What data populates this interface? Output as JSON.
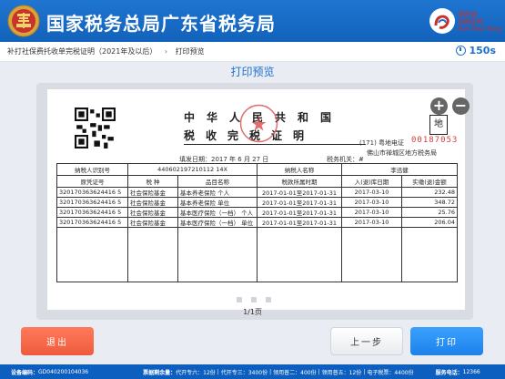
{
  "header": {
    "title": "国家税务总局广东省税务局",
    "brand_line1": "粤税通",
    "brand_line2": "自助办税",
    "brand_line3": "Yue Shui Tong"
  },
  "breadcrumb": {
    "item1": "补打社保费托收单完税证明（2021年及以后）",
    "separator": "›",
    "item2": "打印预览"
  },
  "timer": {
    "text": "150s"
  },
  "page_title": "打印预览",
  "certificate": {
    "title_line1": "中华人民共和国",
    "title_line2": "税收完税证明",
    "cert_no_label": "(171) 粤地电证",
    "cert_no": "00187053",
    "office": "佛山市禅城区地方税务局",
    "stamp_char": "地",
    "fill_date": "填发日期：2017 年 6 月 27 日",
    "tax_org": "税务机关：#",
    "taxpayer_id_label": "纳税人识别号",
    "taxpayer_id": "440602197210112 14X",
    "taxpayer_name_label": "纳税人名称",
    "taxpayer_name": "李迅健",
    "columns": [
      "原凭证号",
      "税 种",
      "品目名称",
      "税款所属时期",
      "入(退)库日期",
      "实缴(退)金额"
    ],
    "rows": [
      [
        "320170363624416 5",
        "社会保险基金",
        "基本养老保险 个人",
        "2017-01-01至2017-01-31",
        "2017-03-10",
        "232.48"
      ],
      [
        "320170363624416 5",
        "社会保险基金",
        "基本养老保险 单位",
        "2017-01-01至2017-01-31",
        "2017-03-10",
        "348.72"
      ],
      [
        "320170363624416 5",
        "社会保险基金",
        "基本医疗保险（一档） 个人",
        "2017-01-01至2017-01-31",
        "2017-03-10",
        "25.76"
      ],
      [
        "320170363624416 5",
        "社会保险基金",
        "基本医疗保险（一档） 单位",
        "2017-01-01至2017-01-31",
        "2017-03-10",
        "206.04"
      ]
    ]
  },
  "zoom": {
    "in": "+",
    "out": "−"
  },
  "pagination": {
    "text": "1/1页"
  },
  "buttons": {
    "exit": "退出",
    "prev": "上一步",
    "print": "打印"
  },
  "footer": {
    "device_label": "设备编码：",
    "device_code": "GD040200104036",
    "stock_label": "票据剩余量：",
    "item1_label": "代开专六：",
    "item1_value": "12份",
    "item2_label": "代开专三：",
    "item2_value": "3400份",
    "item3_label": "领用普二：",
    "item3_value": "400份",
    "item4_label": "领用普五：",
    "item4_value": "12份",
    "item5_label": "电子税票：",
    "item5_value": "4400份",
    "hotline_label": "服务电话：",
    "hotline": "12366"
  },
  "colors": {
    "header_bg": "#1262bb",
    "accent": "#1d6fd0",
    "exit_button": "#f05a3c",
    "print_button": "#1c82ea",
    "cert_no": "#d43c3c"
  }
}
